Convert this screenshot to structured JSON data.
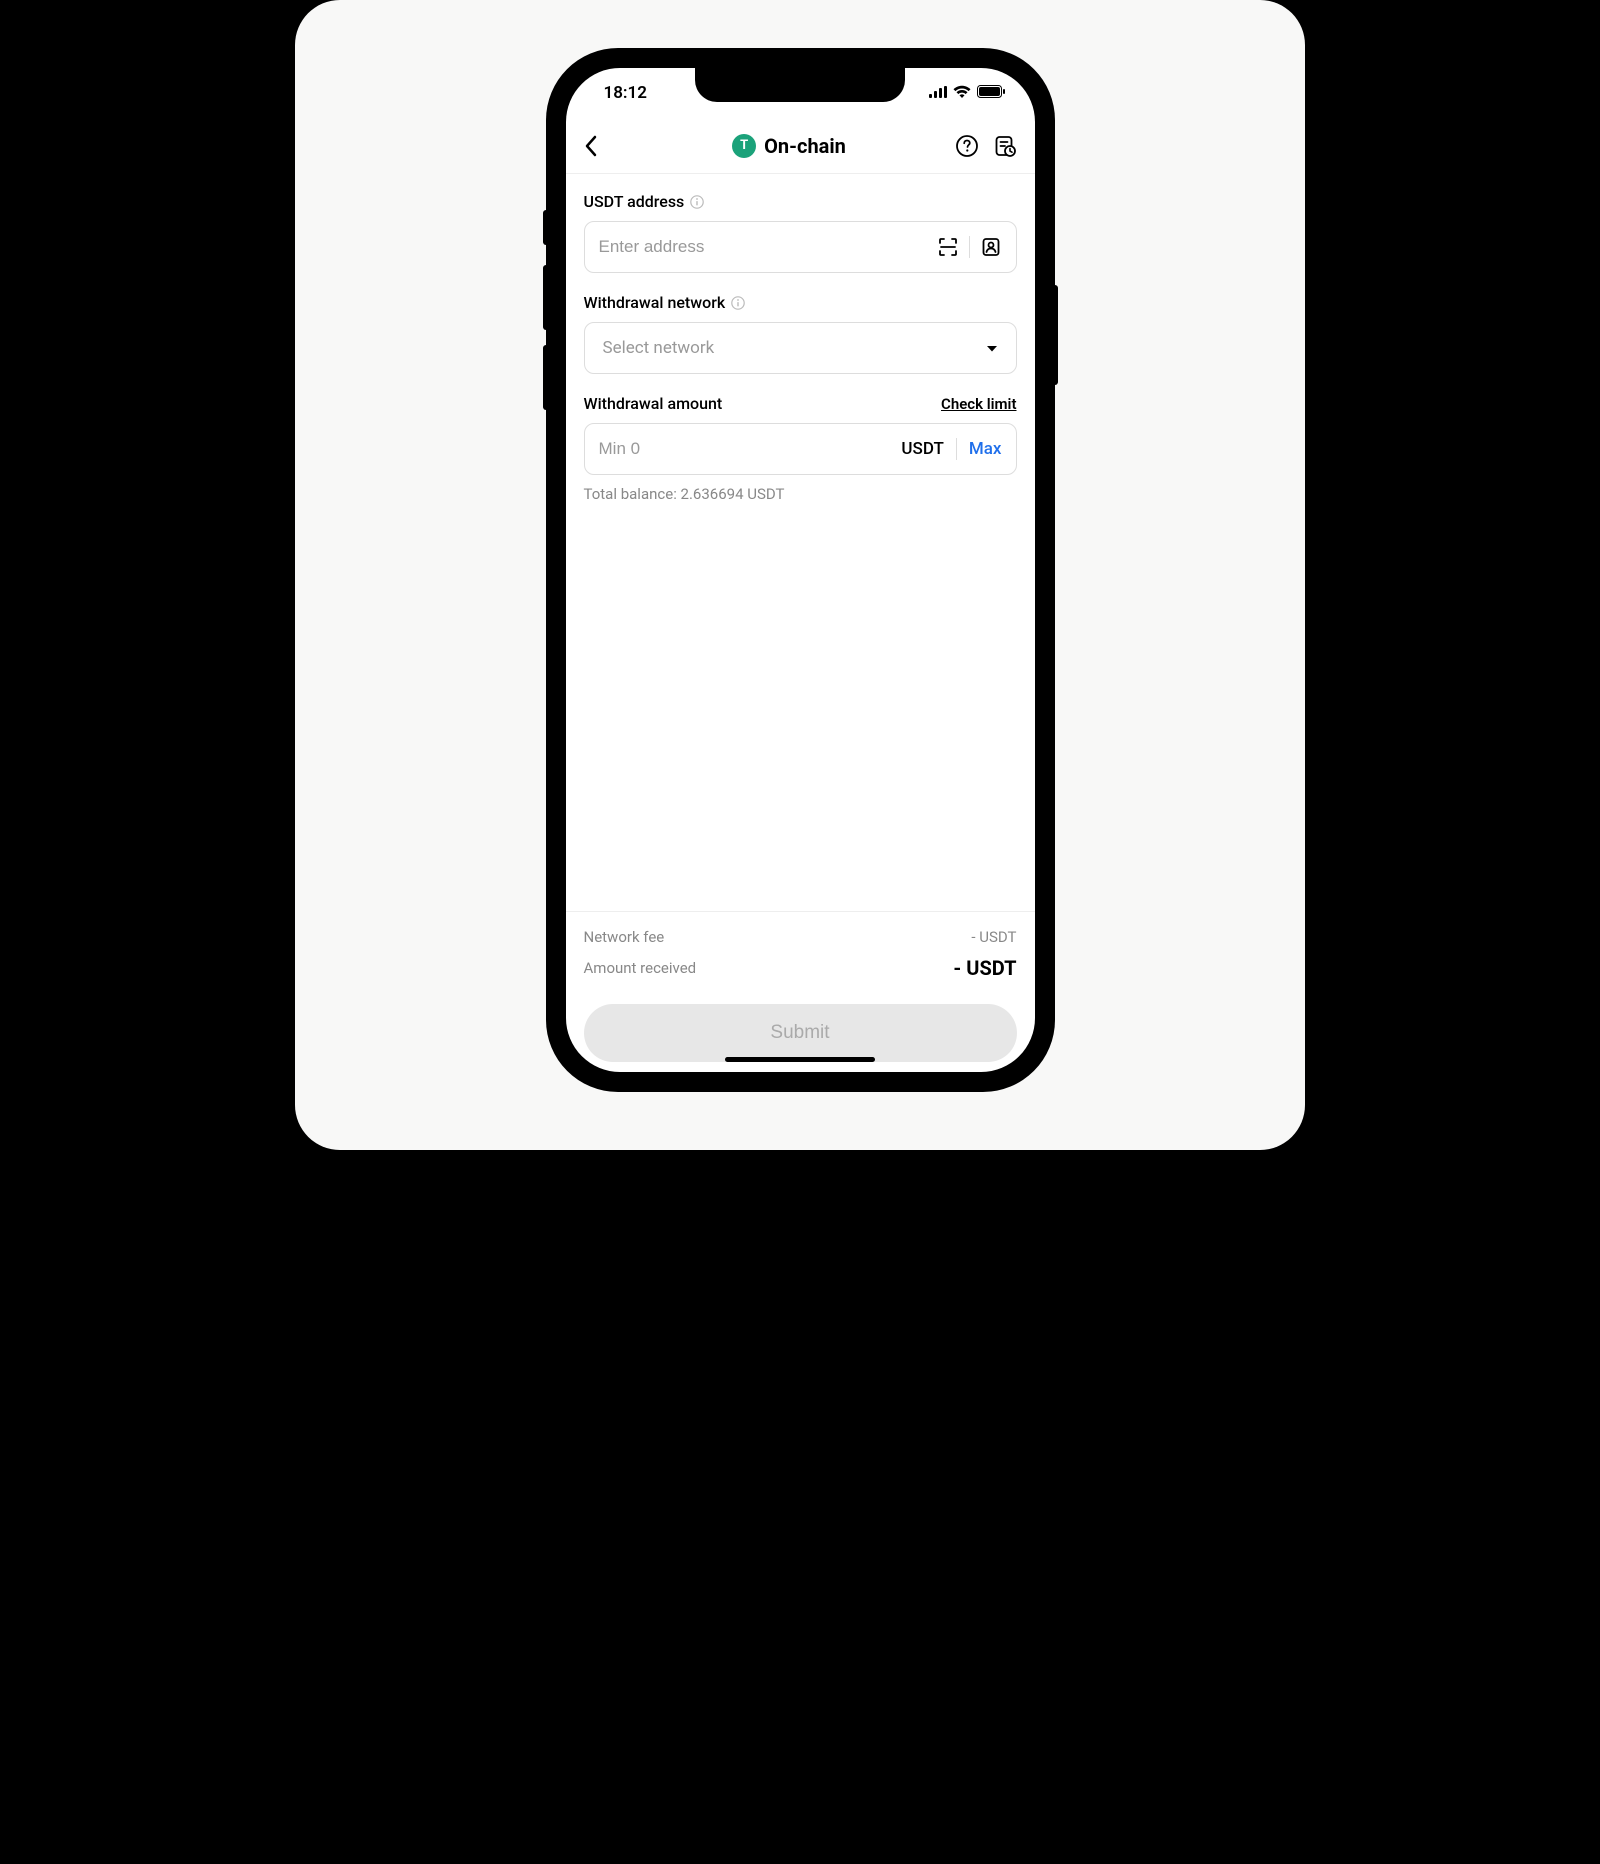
{
  "status": {
    "time": "18:12"
  },
  "header": {
    "title": "On-chain",
    "coin_symbol": "T"
  },
  "address": {
    "label": "USDT address",
    "placeholder": "Enter address"
  },
  "network": {
    "label": "Withdrawal network",
    "placeholder": "Select network"
  },
  "amount": {
    "label": "Withdrawal amount",
    "check_limit": "Check limit",
    "placeholder": "Min 0",
    "currency": "USDT",
    "max_label": "Max"
  },
  "balance": {
    "text": "Total balance: 2.636694 USDT"
  },
  "summary": {
    "fee_label": "Network fee",
    "fee_value": "- USDT",
    "received_label": "Amount received",
    "received_value": "- USDT"
  },
  "submit": {
    "label": "Submit"
  }
}
